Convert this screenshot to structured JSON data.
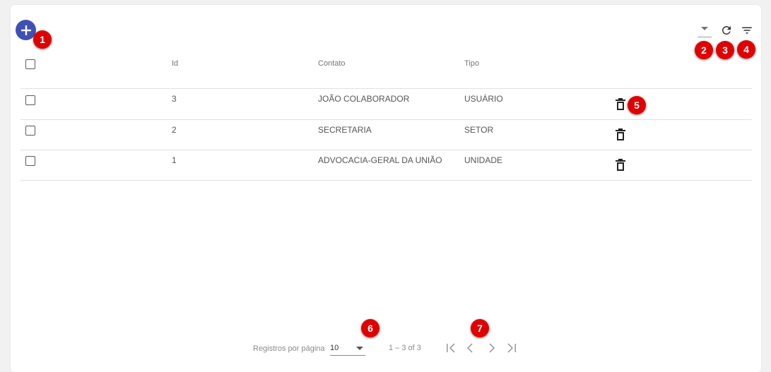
{
  "toolbar": {
    "add_icon": "plus-icon",
    "select_icon": "caret-down-icon",
    "refresh_icon": "refresh-icon",
    "filter_icon": "filter-icon"
  },
  "markers": [
    "1",
    "2",
    "3",
    "4",
    "5",
    "6",
    "7"
  ],
  "table": {
    "headers": {
      "id": "Id",
      "contato": "Contato",
      "tipo": "Tipo"
    },
    "rows": [
      {
        "id": "3",
        "contato": "JOÃO COLABORADOR",
        "tipo": "USUÁRIO"
      },
      {
        "id": "2",
        "contato": "SECRETARIA",
        "tipo": "SETOR"
      },
      {
        "id": "1",
        "contato": "ADVOCACIA-GERAL DA UNIÃO",
        "tipo": "UNIDADE"
      }
    ]
  },
  "paginator": {
    "page_size_label": "Registros por página",
    "page_size_value": "10",
    "range_label": "1 – 3 of 3"
  },
  "colors": {
    "accent": "#3f51b5",
    "marker": "#e00000",
    "background": "#f1f1f1"
  }
}
